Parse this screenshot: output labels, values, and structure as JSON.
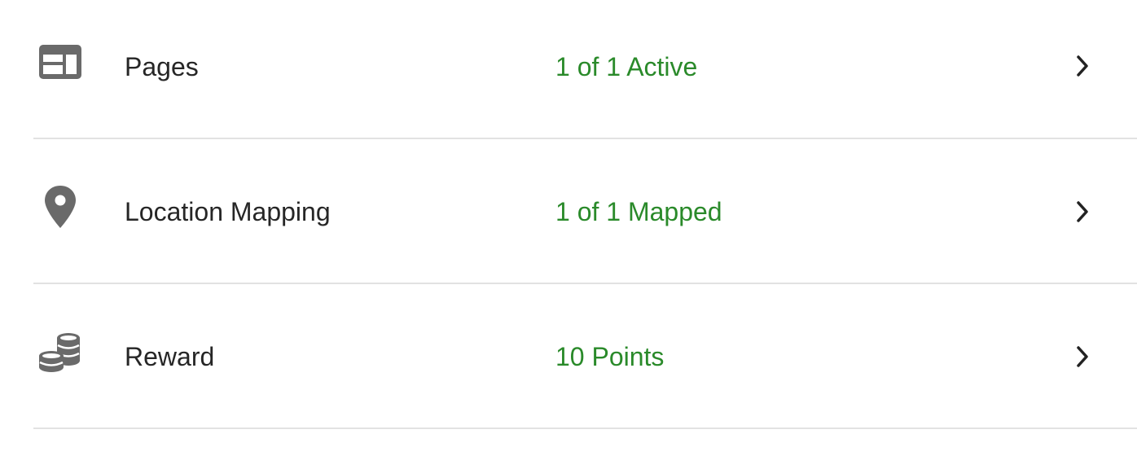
{
  "theme": {
    "icon_color": "#6a6a6a",
    "status_color": "#2a8a2a",
    "text_color": "#262626",
    "divider_color": "#e2e2e2",
    "chevron_color": "#222222"
  },
  "items": [
    {
      "icon": "pages-icon",
      "label": "Pages",
      "status": "1 of 1 Active"
    },
    {
      "icon": "location-pin-icon",
      "label": "Location Mapping",
      "status": "1 of 1 Mapped"
    },
    {
      "icon": "coins-icon",
      "label": "Reward",
      "status": "10 Points"
    }
  ]
}
